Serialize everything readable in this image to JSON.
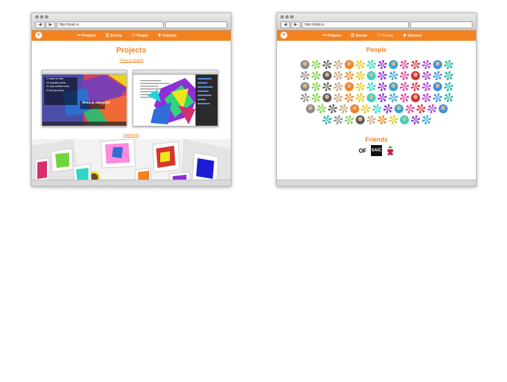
{
  "windows": [
    {
      "url": "http://lolab.io",
      "nav": [
        "Projects",
        "Events",
        "People",
        "Connect"
      ],
      "active_nav": "Projects",
      "page_title": "Projects",
      "project_links": [
        "Three.js playlist",
        "Datamosh"
      ],
      "playground_text": "three.js playgrnd",
      "playground_items": [
        "10 days of code",
        "20 beautiful works",
        "01 loop creative code",
        "02 dev.bg works"
      ]
    },
    {
      "url": "http://lolab.io",
      "nav": [
        "Projects",
        "Events",
        "People",
        "Connect"
      ],
      "active_nav": "People",
      "page_title": "People",
      "friends_title": "Friends",
      "friends_logos": [
        "OF",
        "SAIC",
        "raspberry-pi"
      ],
      "people_rows": [
        14,
        14,
        14,
        14,
        13,
        10
      ]
    }
  ],
  "nav_icons": [
    "share-icon",
    "list-icon",
    "heart-icon",
    "plus-icon"
  ],
  "colors": {
    "accent": "#f58220",
    "active_nav": "#fcd7a9"
  }
}
